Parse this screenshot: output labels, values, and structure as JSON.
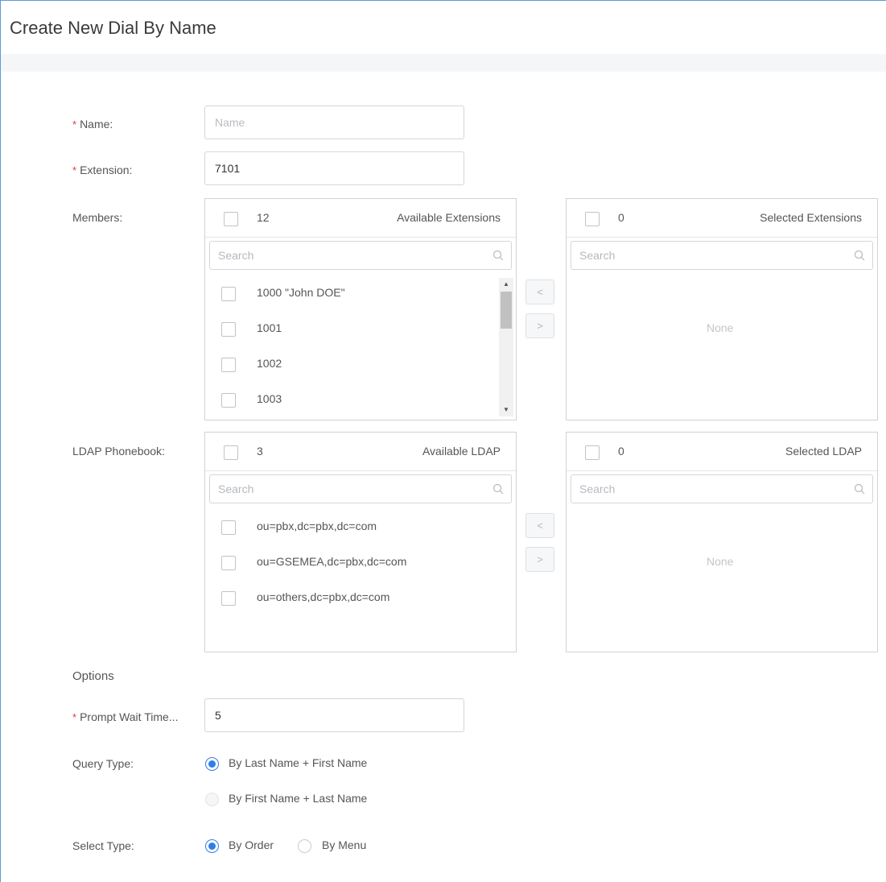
{
  "header": {
    "title": "Create New Dial By Name"
  },
  "form": {
    "name_label": "Name:",
    "name_placeholder": "Name",
    "name_value": "",
    "extension_label": "Extension:",
    "extension_value": "7101",
    "members_label": "Members:",
    "ldap_label": "LDAP Phonebook:",
    "options_label": "Options",
    "prompt_wait_label": "Prompt Wait Time...",
    "prompt_wait_value": "5",
    "query_type_label": "Query Type:",
    "select_type_label": "Select Type:",
    "required_mark": "*"
  },
  "members": {
    "available": {
      "count": "12",
      "title": "Available Extensions",
      "search_placeholder": "Search",
      "items": [
        "1000 \"John DOE\"",
        "1001",
        "1002",
        "1003"
      ]
    },
    "selected": {
      "count": "0",
      "title": "Selected Extensions",
      "search_placeholder": "Search",
      "empty_text": "None"
    },
    "move_left": "<",
    "move_right": ">"
  },
  "ldap": {
    "available": {
      "count": "3",
      "title": "Available LDAP",
      "search_placeholder": "Search",
      "items": [
        "ou=pbx,dc=pbx,dc=com",
        "ou=GSEMEA,dc=pbx,dc=com",
        "ou=others,dc=pbx,dc=com"
      ]
    },
    "selected": {
      "count": "0",
      "title": "Selected LDAP",
      "search_placeholder": "Search",
      "empty_text": "None"
    },
    "move_left": "<",
    "move_right": ">"
  },
  "query_type": {
    "options": [
      "By Last Name + First Name",
      "By First Name + Last Name"
    ],
    "selected": "By Last Name + First Name"
  },
  "select_type": {
    "options": [
      "By Order",
      "By Menu"
    ],
    "selected": "By Order"
  },
  "icons": {
    "search": "search-icon",
    "scroll_up": "triangle-up-icon",
    "scroll_down": "triangle-down-icon"
  },
  "colors": {
    "accent": "#2f7ee6",
    "required": "#e2393b",
    "frame": "#5b9bd5"
  }
}
